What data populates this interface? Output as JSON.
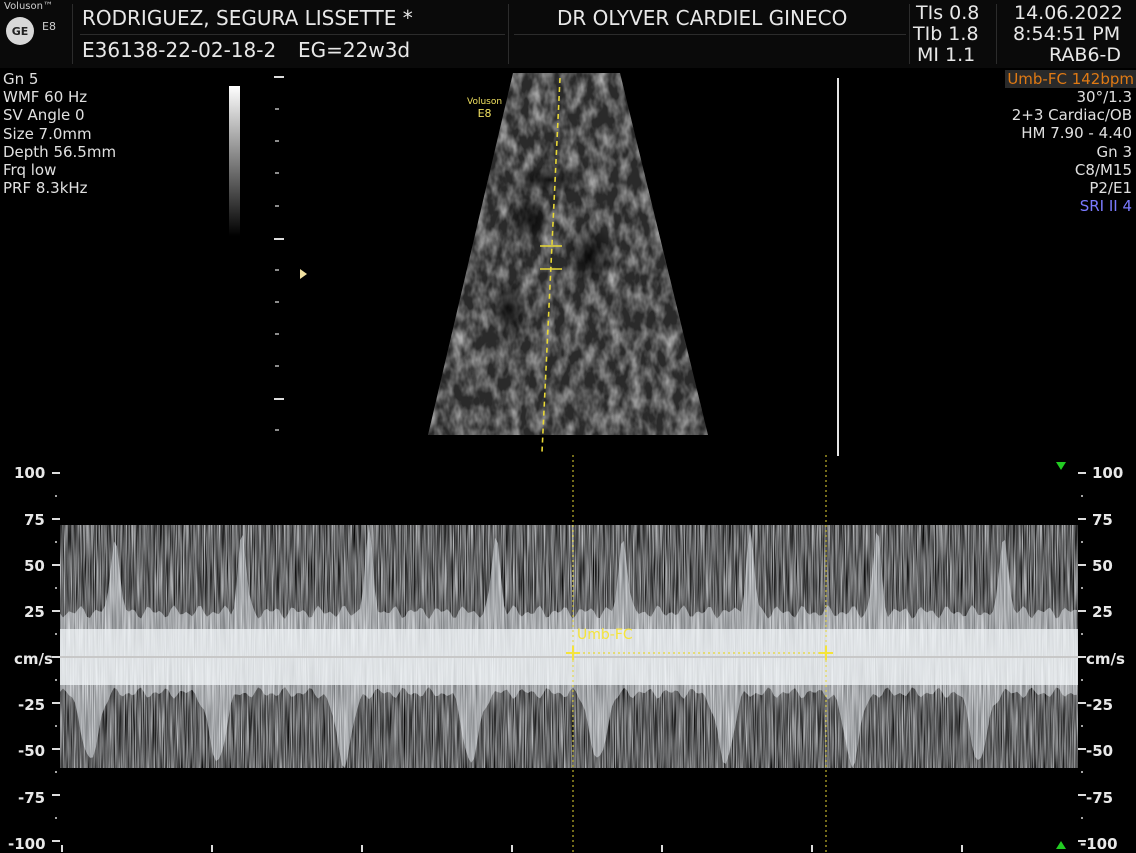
{
  "header": {
    "brand": "Voluson™",
    "model": "E8",
    "ge_logo": "GE",
    "patient_name": "RODRIGUEZ, SEGURA LISSETTE *",
    "patient_id": "E36138-22-02-18-2",
    "gestational_age": "EG=22w3d",
    "physician": "DR OLYVER CARDIEL GINECO",
    "tis": "TIs  0.8",
    "tib": "TIb  1.8",
    "mi": "MI  1.1",
    "date": "14.06.2022",
    "time": "8:54:51 PM",
    "probe": "RAB6-D"
  },
  "left_params": [
    "Gn  5",
    "WMF 60 Hz",
    "SV Angle  0",
    "Size  7.0mm",
    "Depth 56.5mm",
    "Frq low",
    "PRF  8.3kHz"
  ],
  "right_params": {
    "badge": "Umb-FC 142bpm",
    "lines": [
      "30°/1.3",
      "2+3 Cardiac/OB",
      "HM  7.90 - 4.40",
      "Gn  3",
      "C8/M15",
      "P2/E1"
    ],
    "sri": "SRI II 4"
  },
  "image_overlay": {
    "logo_line1": "Voluson",
    "logo_line2": "E8"
  },
  "doppler": {
    "unit": "cm/s",
    "left_ticks": [
      "100",
      "75",
      "50",
      "25",
      "-25",
      "-50",
      "-75",
      "-100"
    ],
    "right_ticks": [
      "100",
      "75",
      "50",
      "25",
      "-25",
      "-50",
      "-75",
      "-100"
    ],
    "measurement_label": "Umb-FC",
    "colors": {
      "caliper": "#f5e43a",
      "marker": "#22cc22",
      "baseline": "#c8c8c8"
    }
  }
}
